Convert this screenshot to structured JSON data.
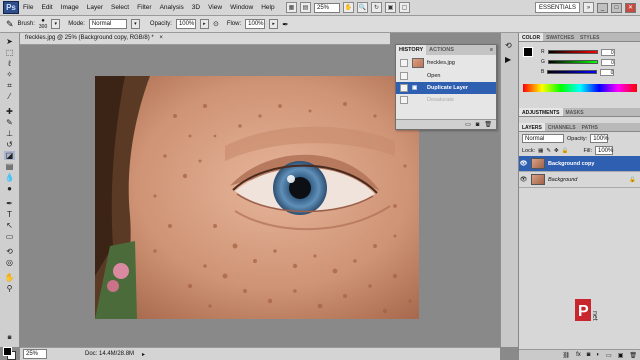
{
  "menubar": {
    "items": [
      "File",
      "Edit",
      "Image",
      "Layer",
      "Select",
      "Filter",
      "Analysis",
      "3D",
      "View",
      "Window",
      "Help"
    ],
    "zoom": "25%",
    "workspace": "ESSENTIALS"
  },
  "options": {
    "brush_label": "Brush:",
    "brush_size": "300",
    "mode_label": "Mode:",
    "mode_value": "Normal",
    "opacity_label": "Opacity:",
    "opacity_value": "100%",
    "flow_label": "Flow:",
    "flow_value": "100%"
  },
  "document": {
    "tab_title": "freckles.jpg @ 25% (Background copy, RGB/8) *",
    "status_zoom": "25%",
    "status_doc": "Doc: 14.4M/28.8M"
  },
  "history_panel": {
    "tabs": [
      "HISTORY",
      "ACTIONS"
    ],
    "snapshot": "freckles.jpg",
    "states": [
      "Open",
      "Duplicate Layer",
      "Desaturate"
    ],
    "selected_index": 1
  },
  "color_panel": {
    "tabs": [
      "COLOR",
      "SWATCHES",
      "STYLES"
    ],
    "channels": [
      {
        "label": "R",
        "value": "0"
      },
      {
        "label": "G",
        "value": "0"
      },
      {
        "label": "B",
        "value": "0"
      }
    ]
  },
  "adjust_panel": {
    "tabs": [
      "ADJUSTMENTS",
      "MASKS"
    ]
  },
  "layers_panel": {
    "tabs": [
      "LAYERS",
      "CHANNELS",
      "PATHS"
    ],
    "blend_mode": "Normal",
    "opacity_label": "Opacity:",
    "opacity_value": "100%",
    "lock_label": "Lock:",
    "fill_label": "Fill:",
    "fill_value": "100%",
    "layers": [
      {
        "name": "Background copy",
        "selected": true
      },
      {
        "name": "Background",
        "selected": false
      }
    ]
  },
  "colors": {
    "accent": "#2f5fb0",
    "ui_gray": "#d6d6d6"
  }
}
